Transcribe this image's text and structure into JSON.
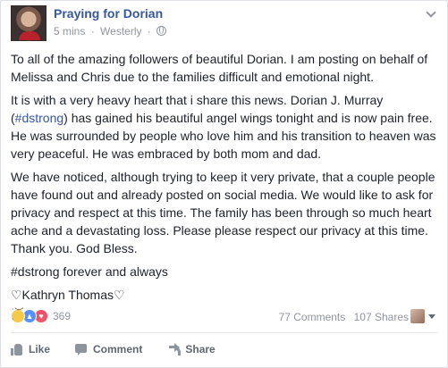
{
  "post": {
    "page_name": "Praying for Dorian",
    "time": "5 mins",
    "location": "Westerly",
    "separator": "·",
    "paragraphs": [
      "To all of the amazing followers of beautiful Dorian. I am posting on behalf of Melissa and Chris due to the families difficult and emotional night.",
      "It is with a very heavy heart that i share this news. Dorian J. Murray (#dstrong) has gained his beautiful angel wings tonight and is now pain free. He was surrounded by people who love him and his transition to heaven was very peaceful. He was embraced by both mom and dad.",
      "We have noticed, although trying to keep it very private, that a couple people have found out and already posted on social media. We would like to ask for privacy and respect at this time. The family has been through so much heart ache and a devastating loss. Please please respect our privacy at this time. Thank you. God Bless.",
      "#dstrong forever and always",
      "♡Kathryn Thomas♡"
    ],
    "p2_before": "It is with a very heavy heart that i share this news. Dorian J. Murray (",
    "p2_hashtag": "#dstrong",
    "p2_after": ") has gained his beautiful angel wings tonight and is now pain free. He was surrounded by people who love him and his transition to heaven was very peaceful. He was embraced by both mom and dad."
  },
  "stats": {
    "reaction_count": "369",
    "comments": "77 Comments",
    "shares": "107 Shares",
    "reaction_icons": [
      "sad-icon",
      "like-icon",
      "love-icon"
    ]
  },
  "actions": {
    "like": "Like",
    "comment": "Comment",
    "share": "Share"
  },
  "colors": {
    "link": "#365899",
    "meta": "#90949c",
    "text": "#1d2129",
    "like_blue": "#5890ff",
    "love_red": "#f25268",
    "sad_yellow": "#f7c948"
  }
}
